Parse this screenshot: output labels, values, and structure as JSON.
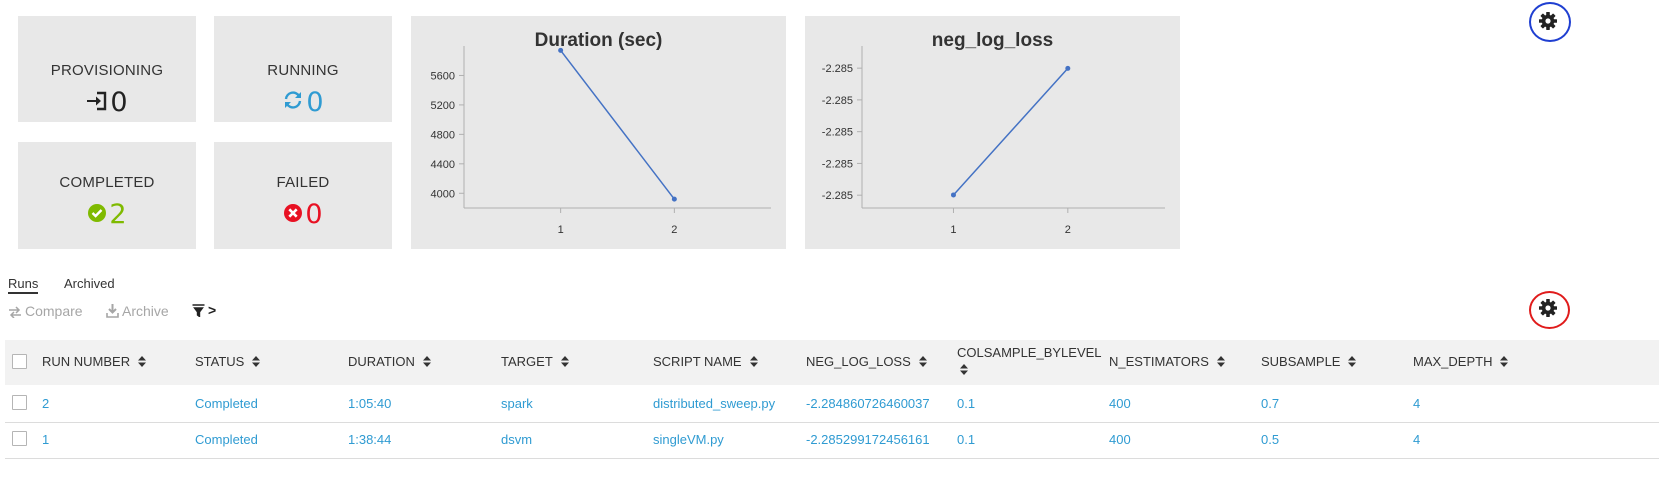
{
  "stats": {
    "provisioning": {
      "label": "PROVISIONING",
      "value": "0",
      "icon": "sign-in-icon",
      "color": "#222222"
    },
    "running": {
      "label": "RUNNING",
      "value": "0",
      "icon": "refresh-icon",
      "color": "#2f9bd2"
    },
    "completed": {
      "label": "COMPLETED",
      "value": "2",
      "icon": "check-circle-icon",
      "color": "#7fba00"
    },
    "failed": {
      "label": "FAILED",
      "value": "0",
      "icon": "times-circle-icon",
      "color": "#e81123"
    }
  },
  "chart_data": [
    {
      "type": "line",
      "title": "Duration (sec)",
      "x": [
        1,
        2
      ],
      "y": [
        5940,
        3920
      ],
      "xticks": [
        "1",
        "2"
      ],
      "yticks": [
        "4000",
        "4400",
        "4800",
        "5200",
        "5600"
      ],
      "ylim": [
        3800,
        6000
      ],
      "xlim": [
        0.15,
        2.85
      ],
      "color": "#4472c4"
    },
    {
      "type": "line",
      "title": "neg_log_loss",
      "x": [
        1,
        2
      ],
      "y": [
        -2.285299172456161,
        -2.284860726460037
      ],
      "xticks": [
        "1",
        "2"
      ],
      "yticks": [
        "-2.285",
        "-2.285",
        "-2.285",
        "-2.285",
        "-2.285"
      ],
      "ylim": [
        -2.2853444,
        -2.2847833
      ],
      "xlim": [
        0.2,
        2.85
      ],
      "color": "#4472c4"
    }
  ],
  "tabs": [
    {
      "label": "Runs",
      "active": true
    },
    {
      "label": "Archived",
      "active": false
    }
  ],
  "toolbar": {
    "compare_label": "Compare",
    "archive_label": "Archive",
    "filter_label": ">"
  },
  "table": {
    "headers": [
      "RUN NUMBER",
      "STATUS",
      "DURATION",
      "TARGET",
      "SCRIPT NAME",
      "NEG_LOG_LOSS",
      "COLSAMPLE_BYLEVEL",
      "N_ESTIMATORS",
      "SUBSAMPLE",
      "MAX_DEPTH"
    ],
    "rows": [
      [
        "2",
        "Completed",
        "1:05:40",
        "spark",
        "distributed_sweep.py",
        "-2.284860726460037",
        "0.1",
        "400",
        "0.7",
        "4"
      ],
      [
        "1",
        "Completed",
        "1:38:44",
        "dsvm",
        "singleVM.py",
        "-2.285299172456161",
        "0.1",
        "400",
        "0.5",
        "4"
      ]
    ]
  },
  "colors": {
    "card_bg": "#e8e8e8",
    "link": "#2f9bd2",
    "highlight_blue": "#1f3fd1",
    "highlight_red": "#e01b1b"
  }
}
